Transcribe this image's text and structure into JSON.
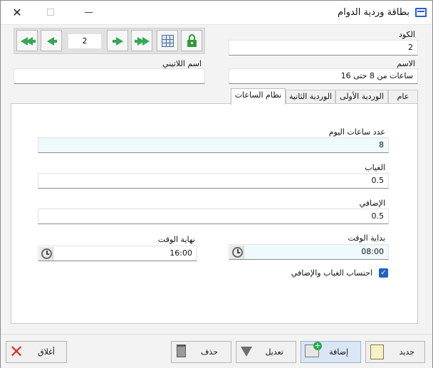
{
  "window": {
    "title": "بطاقة وردية الدوام",
    "close_glyph": "✕"
  },
  "navigation": {
    "page_number": "2"
  },
  "fields": {
    "code_label": "الكود",
    "code_value": "2",
    "name_label": "الاسم",
    "name_value": "ساعات من 8 حتى 16",
    "latin_name_label": "اسم اللاتيني",
    "latin_name_value": ""
  },
  "tabs": [
    {
      "label": "عام"
    },
    {
      "label": "الوردية الأولى"
    },
    {
      "label": "الوردية الثانية"
    },
    {
      "label": "نظام الساعات"
    }
  ],
  "hours_system": {
    "daily_hours_label": "عدد ساعات اليوم",
    "daily_hours_value": "8",
    "absence_label": "الغياب",
    "absence_value": "0.5",
    "overtime_label": "الإضافي",
    "overtime_value": "0.5",
    "start_time_label": "بداية الوقت",
    "start_time_value": "08:00",
    "end_time_label": "نهاية الوقت",
    "end_time_value": "16:00",
    "calc_checkbox_label": "احتساب الغياب والإضافي",
    "calc_checkbox_checked": true
  },
  "footer": {
    "new_label": "جديد",
    "add_label": "إضافة",
    "edit_label": "تعديل",
    "delete_label": "حذف",
    "close_label": "أغلاق"
  },
  "colors": {
    "accent": "#1e63c7",
    "nav_arrow": "#34a853",
    "highlight_field": "#eefafe",
    "close_x": "#e03030"
  }
}
